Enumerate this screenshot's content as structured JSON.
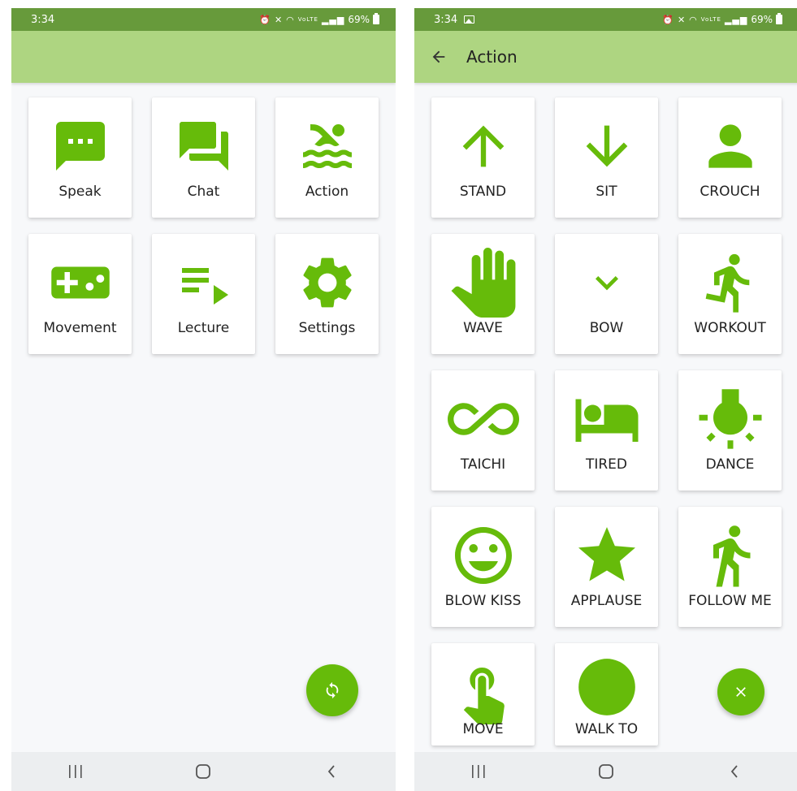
{
  "colors": {
    "accent": "#66bb0a",
    "statusbar": "#679a3b",
    "appbar": "#aed581"
  },
  "left": {
    "status": {
      "time": "3:34",
      "signal": "VoLTE",
      "battery": "69%"
    },
    "tiles": [
      {
        "label": "Speak",
        "icon": "message-icon"
      },
      {
        "label": "Chat",
        "icon": "chat-icon"
      },
      {
        "label": "Action",
        "icon": "swimming-icon"
      },
      {
        "label": "Movement",
        "icon": "gamepad-icon"
      },
      {
        "label": "Lecture",
        "icon": "playlist-icon"
      },
      {
        "label": "Settings",
        "icon": "gear-icon"
      }
    ],
    "fab_icon": "sync-icon"
  },
  "right": {
    "status": {
      "time": "3:34",
      "signal": "VoLTE",
      "battery": "69%"
    },
    "title": "Action",
    "tiles": [
      {
        "label": "STAND",
        "icon": "arrow-up-icon"
      },
      {
        "label": "SIT",
        "icon": "arrow-down-icon"
      },
      {
        "label": "CROUCH",
        "icon": "person-icon"
      },
      {
        "label": "WAVE",
        "icon": "hand-icon"
      },
      {
        "label": "BOW",
        "icon": "chevron-down-icon"
      },
      {
        "label": "WORKOUT",
        "icon": "running-icon"
      },
      {
        "label": "TAICHI",
        "icon": "infinity-icon"
      },
      {
        "label": "TIRED",
        "icon": "bed-icon"
      },
      {
        "label": "DANCE",
        "icon": "sun-icon"
      },
      {
        "label": "BLOW KISS",
        "icon": "smile-icon"
      },
      {
        "label": "APPLAUSE",
        "icon": "star-icon"
      },
      {
        "label": "FOLLOW ME",
        "icon": "walking-icon"
      },
      {
        "label": "MOVE",
        "icon": "touch-icon"
      },
      {
        "label": "WALK TO",
        "icon": "circle-icon"
      }
    ],
    "fab_icon": "close-icon"
  },
  "navbar": {
    "buttons": [
      "recents-icon",
      "home-icon",
      "back-icon"
    ]
  }
}
